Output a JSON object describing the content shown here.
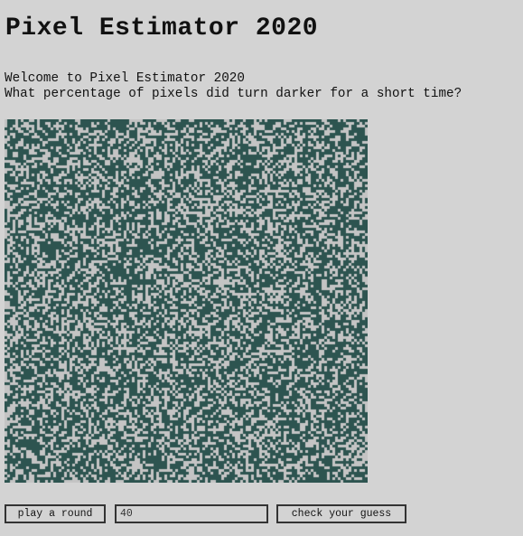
{
  "app": {
    "title": "Pixel Estimator 2020"
  },
  "intro": {
    "welcome": "Welcome to Pixel Estimator 2020",
    "question": "What percentage of pixels did turn darker for a short time?"
  },
  "pixel_field": {
    "dark_color": "#2d5450",
    "light_color": "#c4c4c4"
  },
  "controls": {
    "play_label": "play a round",
    "guess_value": "40",
    "check_label": "check your guess"
  }
}
